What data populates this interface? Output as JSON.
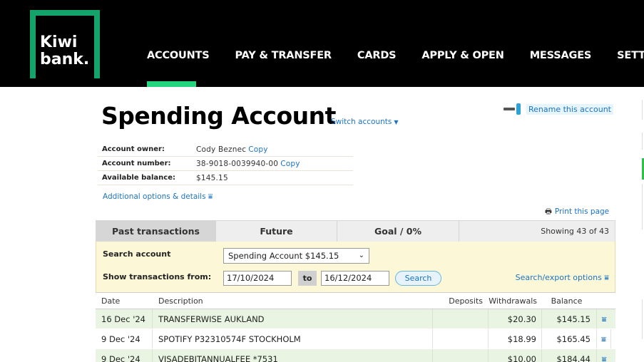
{
  "header": {
    "logo_line1": "Kiwi",
    "logo_line2": "bank.",
    "nav": [
      {
        "label": "ACCOUNTS",
        "active": true
      },
      {
        "label": "PAY & TRANSFER",
        "active": false
      },
      {
        "label": "CARDS",
        "active": false
      },
      {
        "label": "APPLY & OPEN",
        "active": false
      },
      {
        "label": "MESSAGES",
        "active": false
      },
      {
        "label": "SETTINGS",
        "active": false
      }
    ]
  },
  "account": {
    "title": "Spending Account",
    "switch_label": "Switch accounts",
    "rename_label": "Rename this account",
    "owner_label": "Account owner:",
    "owner_value": "Cody Beznec",
    "number_label": "Account number:",
    "number_value": "38-9018-0039940-00",
    "copy_label": "Copy",
    "balance_label": "Available balance:",
    "balance_value": "$145.15",
    "more_label": "Additional options & details",
    "print_label": "Print this page"
  },
  "tabs": {
    "items": [
      "Past transactions",
      "Future",
      "Goal / 0%"
    ],
    "showing": "Showing 43 of 43"
  },
  "search": {
    "account_label": "Search account",
    "account_value": "Spending Account $145.15",
    "from_label": "Show transactions from:",
    "date_from": "17/10/2024",
    "to_label": "to",
    "date_to": "16/12/2024",
    "search_button": "Search",
    "export_label": "Search/export options"
  },
  "table": {
    "columns": [
      "Date",
      "Description",
      "Deposits",
      "Withdrawals",
      "Balance"
    ],
    "rows": [
      {
        "date": "16 Dec '24",
        "desc": "TRANSFERWISE AUKLAND",
        "deposit": "",
        "withdrawal": "$20.30",
        "balance": "$145.15"
      },
      {
        "date": "9 Dec '24",
        "desc": "SPOTIFY P32310574F STOCKHOLM",
        "deposit": "",
        "withdrawal": "$18.99",
        "balance": "$165.45"
      },
      {
        "date": "9 Dec '24",
        "desc": "VISADEBITANNUALFEE *7531",
        "deposit": "",
        "withdrawal": "$10.00",
        "balance": "$184.44"
      }
    ]
  },
  "colors": {
    "header_bg": "#000000",
    "brand_green": "#13a36b",
    "active_underline": "#24d47e",
    "link_blue": "#1a73c6",
    "search_panel_bg": "#fcf7d6",
    "row_green": "#e9f5e2"
  }
}
